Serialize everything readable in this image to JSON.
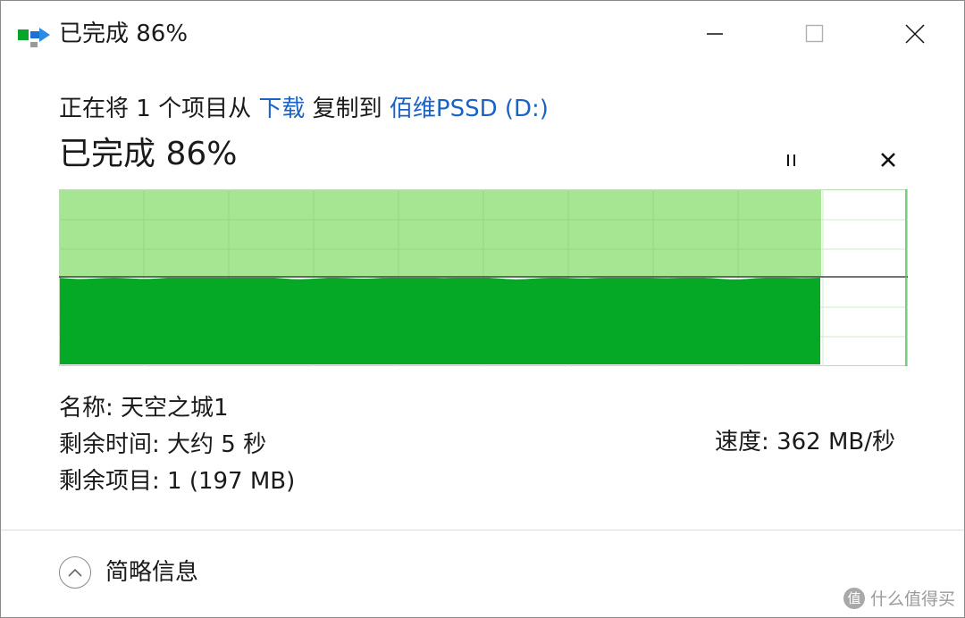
{
  "window": {
    "title": "已完成 86%",
    "icon": "file-copy-icon"
  },
  "copy_info": {
    "prefix": "正在将 1 个项目从 ",
    "source": "下载",
    "middle": " 复制到 ",
    "destination": "佰维PSSD (D:)"
  },
  "progress": {
    "status": "已完成 86%",
    "percent": 86,
    "speed_label": "速度: 362 MB/秒"
  },
  "details": {
    "name": "名称: 天空之城1",
    "time_remaining": "剩余时间: 大约 5 秒",
    "items_remaining": "剩余项目: 1 (197 MB)"
  },
  "footer": {
    "toggle_label": "简略信息"
  },
  "watermark": {
    "text": "什么值得买",
    "logo": "值"
  },
  "colors": {
    "fill_dark": "#05a925",
    "fill_light": "#a6e591",
    "link": "#1a63c5"
  }
}
